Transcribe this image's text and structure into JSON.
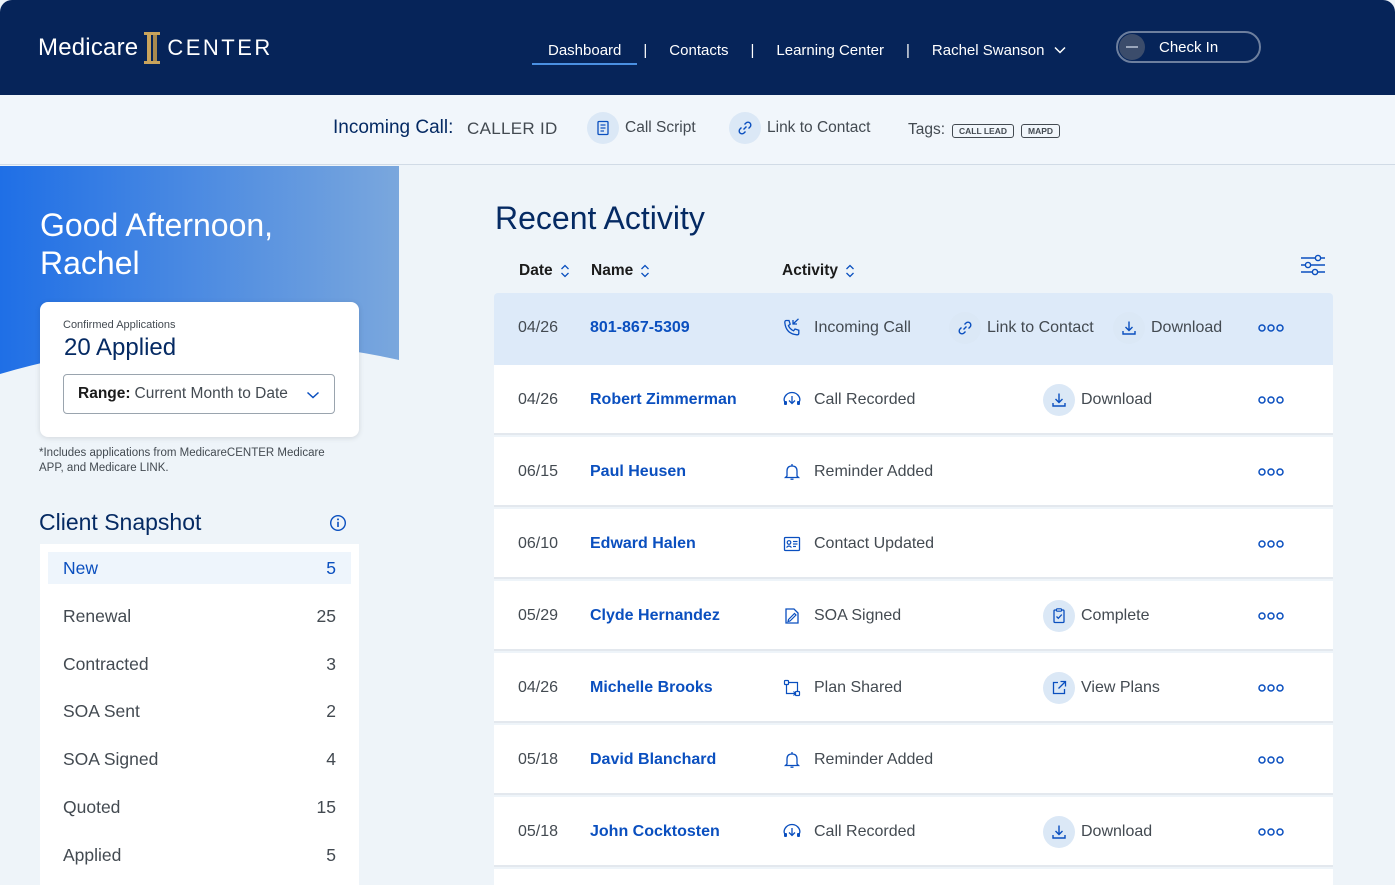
{
  "brand": {
    "part1": "Medicare",
    "part2": "CENTER"
  },
  "nav": {
    "items": [
      "Dashboard",
      "Contacts",
      "Learning Center"
    ],
    "separator": "|",
    "user": "Rachel Swanson",
    "checkin": "Check In"
  },
  "callbar": {
    "label": "Incoming Call:",
    "caller": "CALLER ID",
    "call_script": "Call Script",
    "link_contact": "Link to Contact",
    "tags_label": "Tags:",
    "tags": [
      "CALL LEAD",
      "MAPD"
    ]
  },
  "greeting": "Good Afternoon, Rachel",
  "applications": {
    "label": "Confirmed Applications",
    "value": "20 Applied",
    "range_label": "Range:",
    "range_value": "Current Month to Date",
    "footnote": "*Includes applications from MedicareCENTER Medicare APP, and Medicare LINK."
  },
  "snapshot": {
    "title": "Client Snapshot",
    "rows": [
      {
        "label": "New",
        "count": "5"
      },
      {
        "label": "Renewal",
        "count": "25"
      },
      {
        "label": "Contracted",
        "count": "3"
      },
      {
        "label": "SOA Sent",
        "count": "2"
      },
      {
        "label": "SOA Signed",
        "count": "4"
      },
      {
        "label": "Quoted",
        "count": "15"
      },
      {
        "label": "Applied",
        "count": "5"
      }
    ]
  },
  "activity": {
    "title": "Recent Activity",
    "columns": {
      "date": "Date",
      "name": "Name",
      "activity": "Activity"
    },
    "rows": [
      {
        "date": "04/26",
        "name": "801-867-5309",
        "activity": "Incoming Call",
        "link": "Link to Contact",
        "action": "Download"
      },
      {
        "date": "04/26",
        "name": "Robert Zimmerman",
        "activity": "Call Recorded",
        "action": "Download"
      },
      {
        "date": "06/15",
        "name": "Paul Heusen",
        "activity": "Reminder Added"
      },
      {
        "date": "06/10",
        "name": "Edward Halen",
        "activity": "Contact Updated"
      },
      {
        "date": "05/29",
        "name": "Clyde Hernandez",
        "activity": "SOA Signed",
        "action": "Complete"
      },
      {
        "date": "04/26",
        "name": "Michelle Brooks",
        "activity": "Plan Shared",
        "action": "View Plans"
      },
      {
        "date": "05/18",
        "name": "David Blanchard",
        "activity": "Reminder Added"
      },
      {
        "date": "05/18",
        "name": "John Cocktosten",
        "activity": "Call Recorded",
        "action": "Download"
      }
    ]
  },
  "colors": {
    "navy": "#062459",
    "link_blue": "#0a4fbf",
    "hero_blue": "#2a6fdc",
    "highlight_row": "#ddeaf9"
  },
  "icons": [
    "logo-mark-icon",
    "chevron-down-icon",
    "script-icon",
    "link-icon",
    "info-icon",
    "sort-icon",
    "filter-icon",
    "incoming-call-icon",
    "call-recorded-icon",
    "bell-icon",
    "contact-card-icon",
    "soa-signed-icon",
    "plan-shared-icon",
    "download-icon",
    "complete-icon",
    "view-plans-icon",
    "more-icon"
  ]
}
